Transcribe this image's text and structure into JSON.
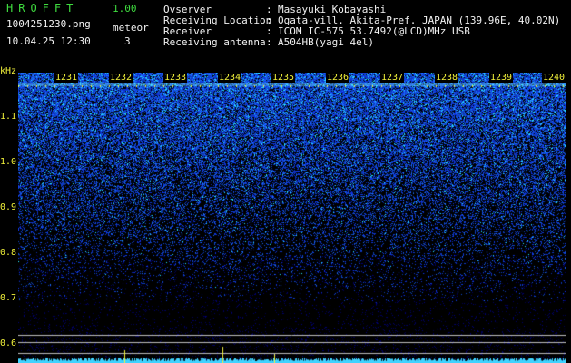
{
  "app": {
    "title": "HROFFT",
    "version": "1.00"
  },
  "file": {
    "name": "1004251230.png",
    "datetime": "10.04.25 12:30"
  },
  "detection": {
    "label": "meteor",
    "count": "3"
  },
  "info": [
    {
      "label": "Ovserver",
      "value": "Masayuki Kobayashi"
    },
    {
      "label": "Receiving Location",
      "value": "Ogata-vill. Akita-Pref. JAPAN (139.96E, 40.02N)"
    },
    {
      "label": "Receiver",
      "value": "ICOM IC-575 53.7492(@LCD)MHz USB"
    },
    {
      "label": "Receiving antenna",
      "value": "A504HB(yagi 4el)"
    }
  ],
  "separator": ":",
  "spectrogram": {
    "y_unit": "kHz",
    "y_ticks": [
      "1.1",
      "1.0",
      "0.9",
      "0.8",
      "0.7",
      "0.6"
    ],
    "x_ticks": [
      "1231",
      "1232",
      "1233",
      "1234",
      "1235",
      "1236",
      "1237",
      "1238",
      "1239",
      "1240"
    ],
    "colors": {
      "axis_label": "#f2f23a",
      "noise": "#1a3cff",
      "hot": "#38e8ff",
      "baseline": "#3fd3ff"
    }
  }
}
